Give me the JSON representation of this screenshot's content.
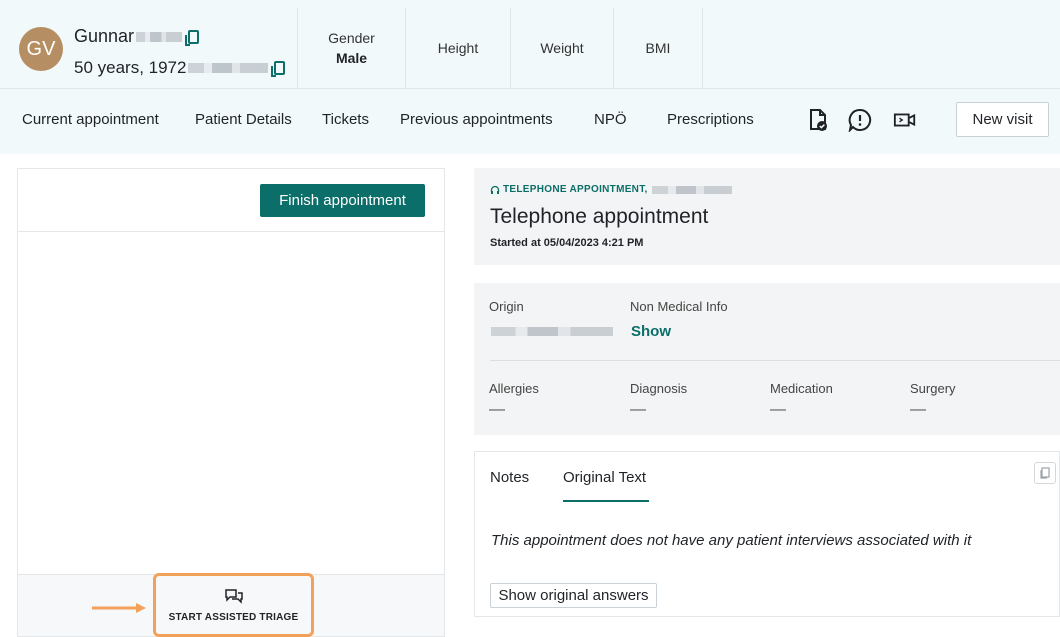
{
  "patient": {
    "initials": "GV",
    "name": "Gunnar",
    "age_line": "50 years, 1972",
    "gender_label": "Gender",
    "gender_value": "Male",
    "height_label": "Height",
    "weight_label": "Weight",
    "bmi_label": "BMI"
  },
  "nav": {
    "items": [
      "Current appointment",
      "Patient Details",
      "Tickets",
      "Previous appointments",
      "NPÖ",
      "Prescriptions"
    ],
    "icons": [
      "document-check-icon",
      "alert-circle-icon",
      "video-camera-icon"
    ],
    "new_visit": "New visit"
  },
  "left_panel": {
    "finish_button": "Finish appointment",
    "triage_label": "START ASSISTED TRIAGE"
  },
  "appointment": {
    "tag": "TELEPHONE APPOINTMENT,",
    "title": "Telephone appointment",
    "started": "Started at 05/04/2023 4:21 PM"
  },
  "info": {
    "origin_label": "Origin",
    "non_medical_label": "Non Medical Info",
    "show_link": "Show",
    "allergies_label": "Allergies",
    "diagnosis_label": "Diagnosis",
    "medication_label": "Medication",
    "surgery_label": "Surgery",
    "empty_value": "—"
  },
  "notes": {
    "tabs": [
      "Notes",
      "Original Text"
    ],
    "active_tab": "Original Text",
    "message": "This appointment does not have any patient interviews associated with it",
    "show_original_button": "Show original answers"
  },
  "colors": {
    "accent": "#0b6e69",
    "highlight": "#f2a15b",
    "avatar": "#b58f63",
    "header_bg": "#f2f9fb"
  }
}
